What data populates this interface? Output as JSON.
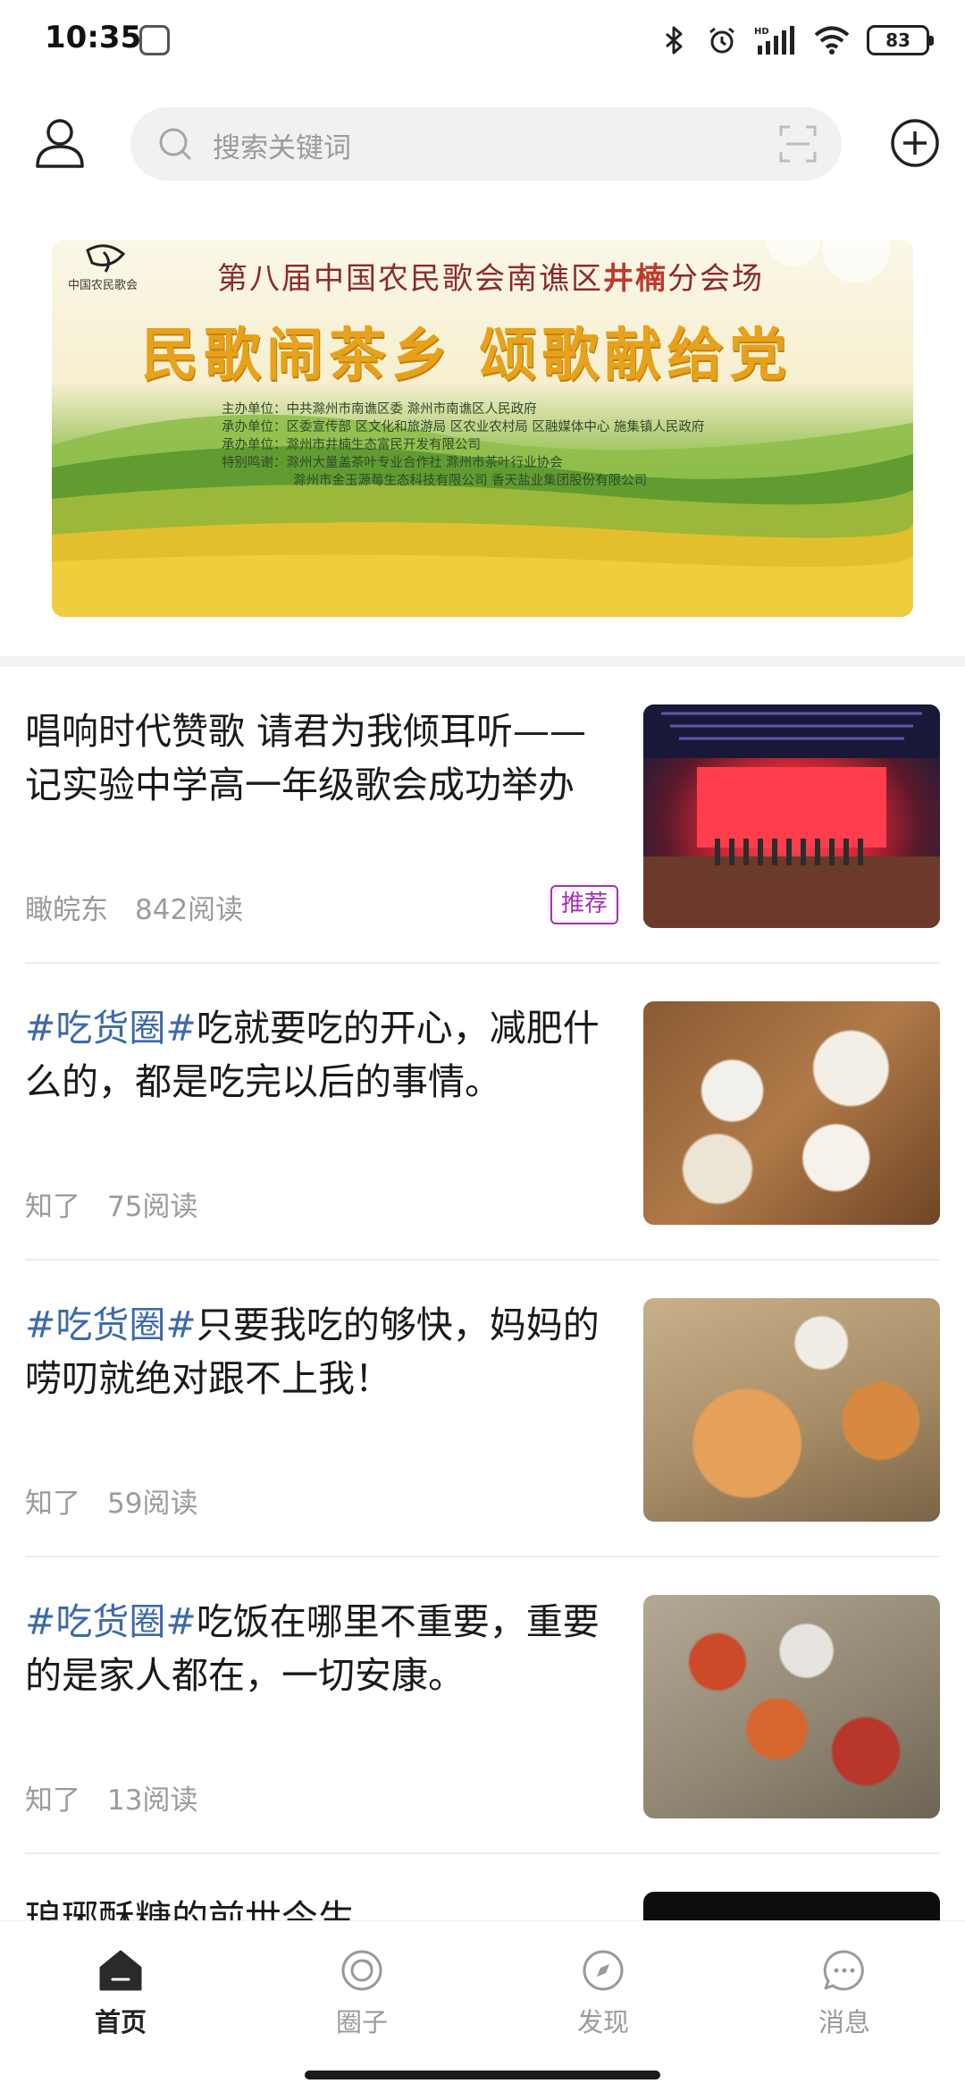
{
  "status_bar": {
    "time": "10:35",
    "battery": "83",
    "icons": [
      "bluetooth-icon",
      "alarm-icon",
      "signal-hd-icon",
      "wifi-icon",
      "battery-icon"
    ]
  },
  "search": {
    "placeholder": "搜索关键词"
  },
  "banner": {
    "line1_prefix": "第八届中国农民歌会南谯区",
    "line1_highlight": "井楠",
    "line1_suffix": "分会场",
    "title": "民歌闹茶乡 颂歌献给党",
    "logo_text": "中国农民歌会",
    "info": [
      "主办单位：中共滁州市南谯区委  滁州市南谯区人民政府",
      "承办单位：区委宣传部  区文化和旅游局  区农业农村局  区融媒体中心  施集镇人民政府",
      "承办单位：滁州市井楠生态富民开发有限公司",
      "特别鸣谢：滁州大量盖茶叶专业合作社  滁州市茶叶行业协会",
      "滁州市金玉源莓生态科技有限公司  香天盐业集团股份有限公司"
    ]
  },
  "feed": [
    {
      "tag": "",
      "text": "唱响时代赞歌 请君为我倾耳听——记实验中学高一年级歌会成功举办",
      "author": "瞰皖东",
      "reads": "842阅读",
      "badge": "推荐"
    },
    {
      "tag": "#吃货圈#",
      "text": "吃就要吃的开心，减肥什么的，都是吃完以后的事情。",
      "author": "知了",
      "reads": "75阅读",
      "badge": ""
    },
    {
      "tag": "#吃货圈#",
      "text": "只要我吃的够快，妈妈的唠叨就绝对跟不上我！",
      "author": "知了",
      "reads": "59阅读",
      "badge": ""
    },
    {
      "tag": "#吃货圈#",
      "text": "吃饭在哪里不重要，重要的是家人都在，一切安康。",
      "author": "知了",
      "reads": "13阅读",
      "badge": ""
    },
    {
      "tag": "",
      "text": "琅琊酥糖的前世今生",
      "author": "",
      "reads": "",
      "badge": ""
    }
  ],
  "bottom_nav": [
    {
      "label": "首页",
      "icon": "home-icon",
      "active": true
    },
    {
      "label": "圈子",
      "icon": "circle-icon",
      "active": false
    },
    {
      "label": "发现",
      "icon": "discover-icon",
      "active": false
    },
    {
      "label": "消息",
      "icon": "message-icon",
      "active": false
    }
  ],
  "colors": {
    "tag": "#3d6aa8",
    "badge": "#a52fb8",
    "meta": "#9b9b9b"
  }
}
